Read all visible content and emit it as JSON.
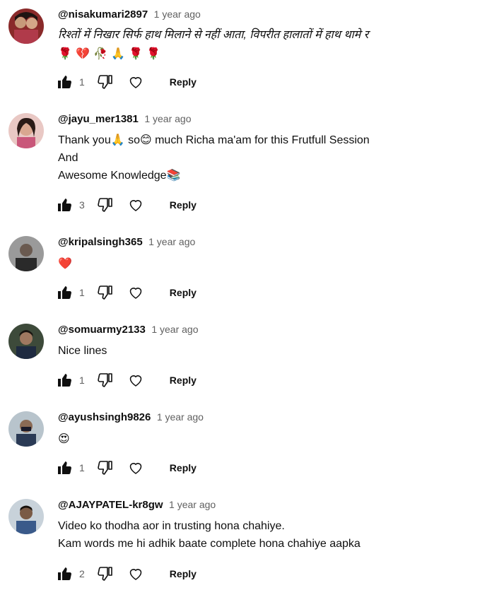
{
  "comments": [
    {
      "handle": "@nisakumari2897",
      "time": "1 year ago",
      "text": "रिश्तों में निखार सिर्फ हाथ मिलाने से नहीं आता, विपरीत हालातों में हाथ थामे र",
      "text2": "🌹 💔 🥀 🙏 🌹 🌹",
      "likes": "1",
      "reply": "Reply",
      "avatar_color": "#7b3a3a"
    },
    {
      "handle": "@jayu_mer1381",
      "time": "1 year ago",
      "text": "Thank you🙏 so😊 much Richa ma'am for this Frutfull Session\nAnd\nAwesome Knowledge📚",
      "likes": "3",
      "reply": "Reply",
      "avatar_color": "#d9a09a"
    },
    {
      "handle": "@kripalsingh365",
      "time": "1 year ago",
      "text": "❤️",
      "likes": "1",
      "reply": "Reply",
      "avatar_color": "#3c3c3c"
    },
    {
      "handle": "@somuarmy2133",
      "time": "1 year ago",
      "text": "Nice lines",
      "likes": "1",
      "reply": "Reply",
      "avatar_color": "#4a3a2e"
    },
    {
      "handle": "@ayushsingh9826",
      "time": "1 year ago",
      "text": "😍",
      "likes": "1",
      "reply": "Reply",
      "avatar_color": "#2f4f6f"
    },
    {
      "handle": "@AJAYPATEL-kr8gw",
      "time": "1 year ago",
      "text": "Video ko thodha aor in trusting hona chahiye.\nKam words me hi adhik baate complete hona chahiye aapka",
      "likes": "2",
      "reply": "Reply",
      "avatar_color": "#5a6e8a"
    }
  ]
}
